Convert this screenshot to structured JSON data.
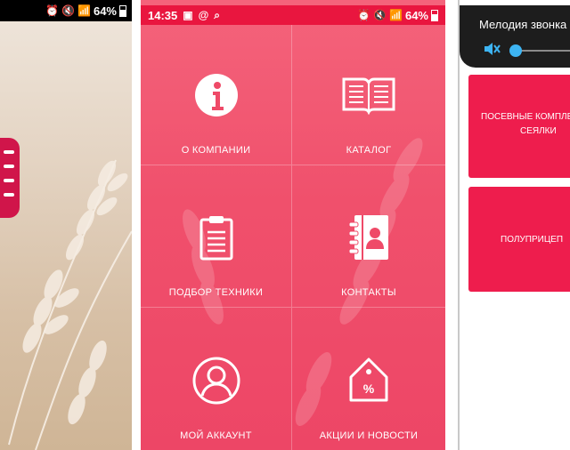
{
  "left_screen": {
    "status_bar": {
      "battery": "64%"
    }
  },
  "main_screen": {
    "status_bar": {
      "time": "14:35",
      "battery": "64%"
    },
    "menu": [
      {
        "label": "О КОМПАНИИ",
        "icon": "info-icon"
      },
      {
        "label": "КАТАЛОГ",
        "icon": "book-icon"
      },
      {
        "label": "ПОДБОР ТЕХНИКИ",
        "icon": "clipboard-icon"
      },
      {
        "label": "КОНТАКТЫ",
        "icon": "contacts-book-icon"
      },
      {
        "label": "МОЙ АККАУНТ",
        "icon": "user-avatar-icon"
      },
      {
        "label": "АКЦИИ И НОВОСТИ",
        "icon": "price-tag-percent-icon"
      }
    ],
    "colors": {
      "status_bar": "#e9163f",
      "background": "#f0506c"
    }
  },
  "right_screen": {
    "volume_panel": {
      "title": "Мелодия звонка"
    },
    "cards": [
      {
        "line1": "ПОСЕВНЫЕ КОМПЛЕ",
        "line2": "СЕЯЛКИ"
      },
      {
        "line1": "ПОЛУПРИЦЕП"
      }
    ],
    "colors": {
      "card": "#ee1d4d"
    }
  }
}
